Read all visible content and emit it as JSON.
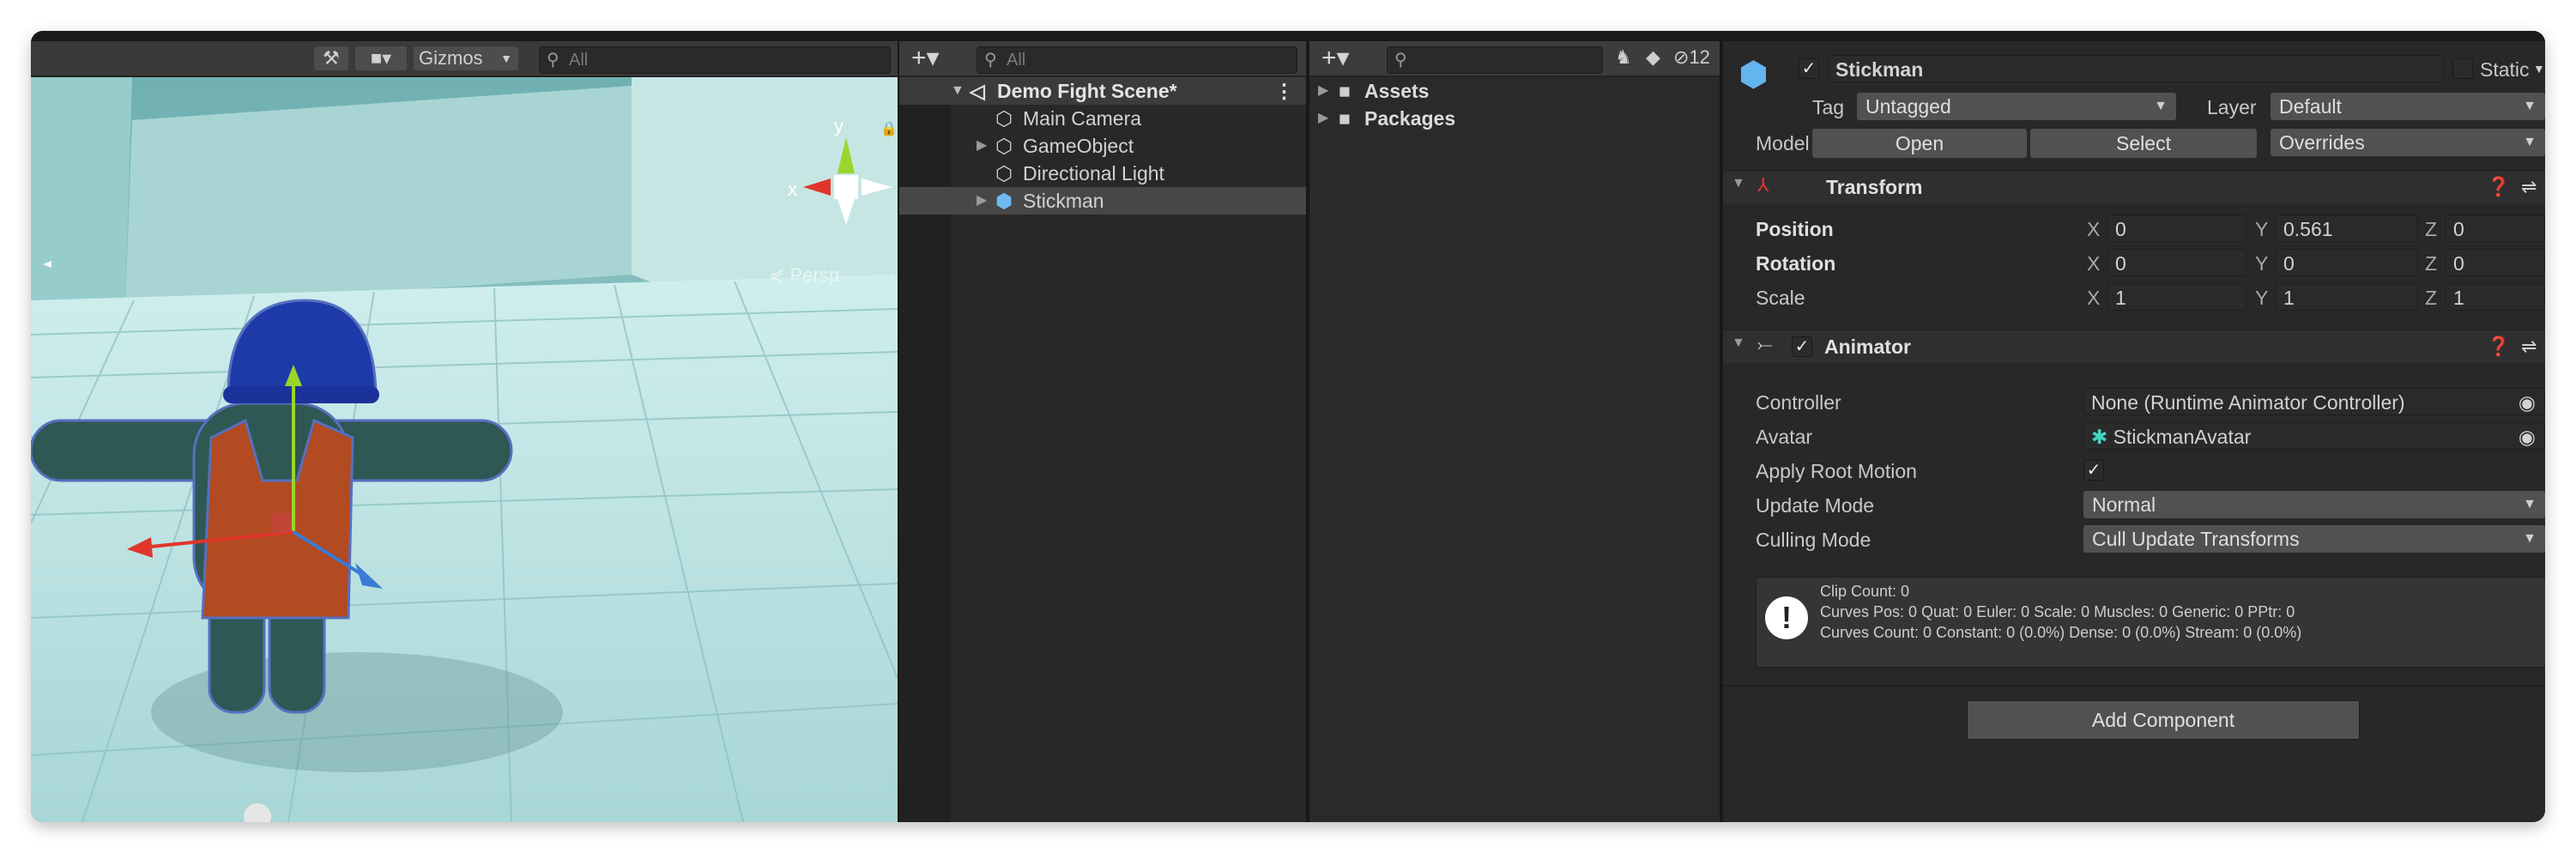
{
  "scene_toolbar": {
    "tools_icon": "tools-icon",
    "camera_icon": "camera-icon",
    "gizmos_label": "Gizmos",
    "search_placeholder": "All"
  },
  "scene_view": {
    "projection_label": "Persp",
    "gizmo_axis_x": "x",
    "gizmo_axis_y": "y"
  },
  "hierarchy": {
    "search_placeholder": "All",
    "scene_name": "Demo Fight Scene*",
    "items": [
      {
        "label": "Main Camera",
        "expandable": false
      },
      {
        "label": "GameObject",
        "expandable": true
      },
      {
        "label": "Directional Light",
        "expandable": false
      },
      {
        "label": "Stickman",
        "expandable": true,
        "selected": true
      }
    ]
  },
  "project": {
    "search_placeholder": "",
    "hidden_count": "12",
    "folders": [
      "Assets",
      "Packages"
    ]
  },
  "inspector": {
    "object_name": "Stickman",
    "static_label": "Static",
    "tag_label": "Tag",
    "tag_value": "Untagged",
    "layer_label": "Layer",
    "layer_value": "Default",
    "model_label": "Model",
    "open_label": "Open",
    "select_label": "Select",
    "overrides_label": "Overrides",
    "transform": {
      "title": "Transform",
      "rows": [
        {
          "label": "Position",
          "bold": true,
          "x": "0",
          "y": "0.561",
          "z": "0"
        },
        {
          "label": "Rotation",
          "bold": true,
          "x": "0",
          "y": "0",
          "z": "0"
        },
        {
          "label": "Scale",
          "bold": false,
          "x": "1",
          "y": "1",
          "z": "1"
        }
      ]
    },
    "animator": {
      "title": "Animator",
      "controller_label": "Controller",
      "controller_value": "None (Runtime Animator Controller)",
      "avatar_label": "Avatar",
      "avatar_value": "StickmanAvatar",
      "apply_root_motion_label": "Apply Root Motion",
      "apply_root_motion": true,
      "update_mode_label": "Update Mode",
      "update_mode_value": "Normal",
      "culling_mode_label": "Culling Mode",
      "culling_mode_value": "Cull Update Transforms",
      "info_lines": [
        "Clip Count: 0",
        "Curves Pos: 0 Quat: 0 Euler: 0 Scale: 0 Muscles: 0 Generic: 0 PPtr: 0",
        "Curves Count: 0 Constant: 0 (0.0%) Dense: 0 (0.0%) Stream: 0 (0.0%)"
      ]
    },
    "add_component_label": "Add Component"
  },
  "colors": {
    "selection": "#474747",
    "panel_bg": "#282828",
    "toolbar_bg": "#3c3c3c",
    "gizmo_x": "#e0352b",
    "gizmo_y": "#9bd52b",
    "gizmo_z": "#3a7bd5"
  }
}
